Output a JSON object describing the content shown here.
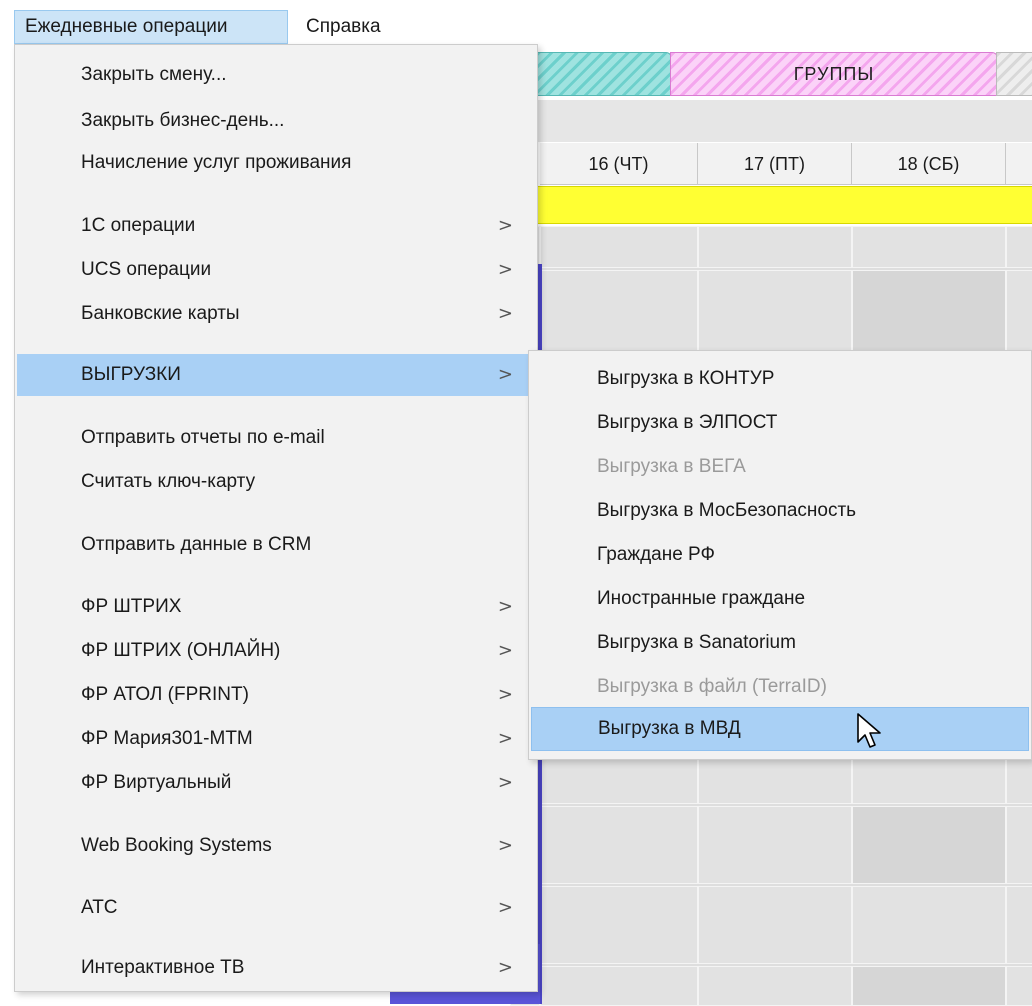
{
  "menubar": {
    "daily_ops": "Ежедневные операции",
    "help": "Справка"
  },
  "background": {
    "tab_groups": "ГРУППЫ",
    "days": [
      "16 (ЧТ)",
      "17 (ПТ)",
      "18 (СБ)"
    ]
  },
  "menu": {
    "items": [
      {
        "label": "Закрыть смену...",
        "submenu": false
      },
      {
        "label": "Закрыть бизнес-день...",
        "submenu": false
      },
      {
        "label": "Начисление услуг проживания",
        "submenu": false
      },
      {
        "label": "1С операции",
        "submenu": true
      },
      {
        "label": "UCS операции",
        "submenu": true
      },
      {
        "label": "Банковские карты",
        "submenu": true
      },
      {
        "label": "ВЫГРУЗКИ",
        "submenu": true,
        "highlighted": true
      },
      {
        "label": "Отправить отчеты по e-mail",
        "submenu": false
      },
      {
        "label": "Считать ключ-карту",
        "submenu": false
      },
      {
        "label": "Отправить данные в CRM",
        "submenu": false
      },
      {
        "label": "ФР ШТРИХ",
        "submenu": true
      },
      {
        "label": "ФР ШТРИХ (ОНЛАЙН)",
        "submenu": true
      },
      {
        "label": "ФР АТОЛ (FPRINT)",
        "submenu": true
      },
      {
        "label": "ФР Мария301-МТМ",
        "submenu": true
      },
      {
        "label": "ФР Виртуальный",
        "submenu": true
      },
      {
        "label": "Web Booking Systems",
        "submenu": true
      },
      {
        "label": "АТС",
        "submenu": true
      },
      {
        "label": "Интерактивное ТВ",
        "submenu": true
      }
    ],
    "arrow_glyph": ">"
  },
  "submenu": {
    "items": [
      {
        "label": "Выгрузка в КОНТУР",
        "enabled": true
      },
      {
        "label": "Выгрузка в ЭЛПОСТ",
        "enabled": true
      },
      {
        "label": "Выгрузка в ВЕГА",
        "enabled": false
      },
      {
        "label": "Выгрузка в МосБезопасность",
        "enabled": true
      },
      {
        "label": "Граждане РФ",
        "enabled": true
      },
      {
        "label": "Иностранные граждане",
        "enabled": true
      },
      {
        "label": "Выгрузка в Sanatorium",
        "enabled": true
      },
      {
        "label": "Выгрузка в файл (TerraID)",
        "enabled": false
      },
      {
        "label": "Выгрузка в МВД",
        "enabled": true,
        "highlighted": true
      }
    ]
  },
  "colors": {
    "highlight": "#a9d0f5",
    "menu_bg": "#f2f2f2",
    "disabled_text": "#9a9a9a",
    "tab_groups": "#f4a6ee",
    "tab_cyan": "#6dd0cc",
    "yellow_band": "#ffff33"
  }
}
